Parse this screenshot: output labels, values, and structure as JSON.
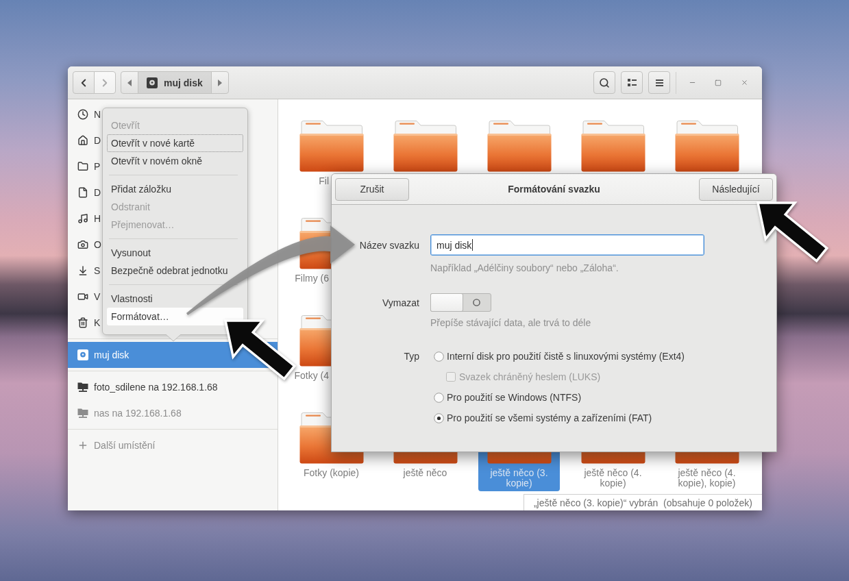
{
  "window": {
    "navigation": [
      {
        "kind": "back",
        "disabled": false
      },
      {
        "kind": "forward",
        "disabled": true
      }
    ],
    "path_bar": {
      "current": "muj disk"
    }
  },
  "sidebar": {
    "sections": [
      {
        "items": [
          {
            "kind": "recent",
            "label": "N",
            "selected": false,
            "dimmed": false
          },
          {
            "kind": "home",
            "label": "D",
            "selected": false,
            "dimmed": false
          },
          {
            "kind": "desktop",
            "label": "P",
            "selected": false,
            "dimmed": false
          },
          {
            "kind": "documents",
            "label": "D",
            "selected": false,
            "dimmed": false
          },
          {
            "kind": "music",
            "label": "H",
            "selected": false,
            "dimmed": false
          },
          {
            "kind": "pictures",
            "label": "O",
            "selected": false,
            "dimmed": false
          },
          {
            "kind": "downloads",
            "label": "S",
            "selected": false,
            "dimmed": false
          },
          {
            "kind": "videos",
            "label": "V",
            "selected": false,
            "dimmed": false
          },
          {
            "kind": "trash",
            "label": "K",
            "selected": false,
            "dimmed": false
          }
        ]
      },
      {
        "items": [
          {
            "kind": "drive",
            "label": "muj disk",
            "selected": true,
            "dimmed": false
          }
        ]
      },
      {
        "items": [
          {
            "kind": "network",
            "label": "foto_sdilene na 192.168.1.68",
            "selected": false,
            "dimmed": false
          },
          {
            "kind": "network",
            "label": "nas na 192.168.1.68",
            "selected": false,
            "dimmed": true
          }
        ]
      },
      {
        "items": [
          {
            "kind": "other",
            "label": "Další umístění",
            "selected": false,
            "dimmed": true
          }
        ]
      }
    ]
  },
  "context_menu": {
    "groups": [
      {
        "items": [
          {
            "label": "Otevřít",
            "disabled": true,
            "focused": false,
            "highlighted": false
          },
          {
            "label": "Otevřít v nové kartě",
            "disabled": false,
            "focused": true,
            "highlighted": false
          },
          {
            "label": "Otevřít v novém okně",
            "disabled": false,
            "focused": false,
            "highlighted": false
          }
        ]
      },
      {
        "items": [
          {
            "label": "Přidat záložku",
            "disabled": false,
            "focused": false,
            "highlighted": false
          },
          {
            "label": "Odstranit",
            "disabled": true,
            "focused": false,
            "highlighted": false
          },
          {
            "label": "Přejmenovat…",
            "disabled": true,
            "focused": false,
            "highlighted": false
          }
        ]
      },
      {
        "items": [
          {
            "label": "Vysunout",
            "disabled": false,
            "focused": false,
            "highlighted": false
          },
          {
            "label": "Bezpečně odebrat jednotku",
            "disabled": false,
            "focused": false,
            "highlighted": false
          }
        ]
      },
      {
        "items": [
          {
            "label": "Vlastnosti",
            "disabled": false,
            "focused": false,
            "highlighted": false
          },
          {
            "label": "Formátovat…",
            "disabled": false,
            "focused": false,
            "highlighted": true
          }
        ]
      }
    ]
  },
  "files": {
    "rows": [
      {
        "items": [
          {
            "label": "Fil",
            "selected": false,
            "cut_off": true
          },
          {
            "selected": false
          },
          {
            "selected": false
          },
          {
            "selected": false
          },
          {
            "selected": false
          }
        ]
      },
      {
        "items": [
          {
            "label": "Filmy (6",
            "selected": false,
            "cut_off": true
          }
        ]
      },
      {
        "items": [
          {
            "label": "Fotky (4",
            "selected": false,
            "cut_off": true
          }
        ]
      },
      {
        "items": [
          {
            "label": "Fotky (kopie)",
            "selected": false,
            "cut_off": false
          },
          {
            "label": "ještě něco",
            "selected": false,
            "cut_off": false
          },
          {
            "label": "ještě něco (3. kopie)",
            "selected": true,
            "cut_off": false
          },
          {
            "label": "ještě něco (4. kopie)",
            "selected": false,
            "cut_off": false
          },
          {
            "label": "ještě něco (4. kopie), kopie)",
            "selected": false,
            "cut_off": false
          }
        ]
      }
    ]
  },
  "status_bar": {
    "text": "„ještě něco (3. kopie)“ vybrán  (obsahuje 0 položek)"
  },
  "dialog": {
    "title": "Formátování svazku",
    "cancel_button": "Zrušit",
    "next_button": "Následující",
    "name_field": {
      "label": "Název svazku",
      "value": "muj disk",
      "hint": "Například „Adélčiny soubory“ nebo „Záloha“."
    },
    "erase": {
      "label": "Vymazat",
      "on": false,
      "hint": "Přepíše stávající data, ale trvá to déle"
    },
    "type": {
      "label": "Typ",
      "options": [
        {
          "label": "Interní disk pro použití čistě s linuxovými systémy (Ext4)",
          "selected": false,
          "suboption": {
            "label": "Svazek chráněný heslem (LUKS)",
            "checked": false,
            "disabled": true
          }
        },
        {
          "label": "Pro použití se Windows (NTFS)",
          "selected": false
        },
        {
          "label": "Pro použití se všemi systémy a zařízeními (FAT)",
          "selected": true
        }
      ]
    }
  }
}
